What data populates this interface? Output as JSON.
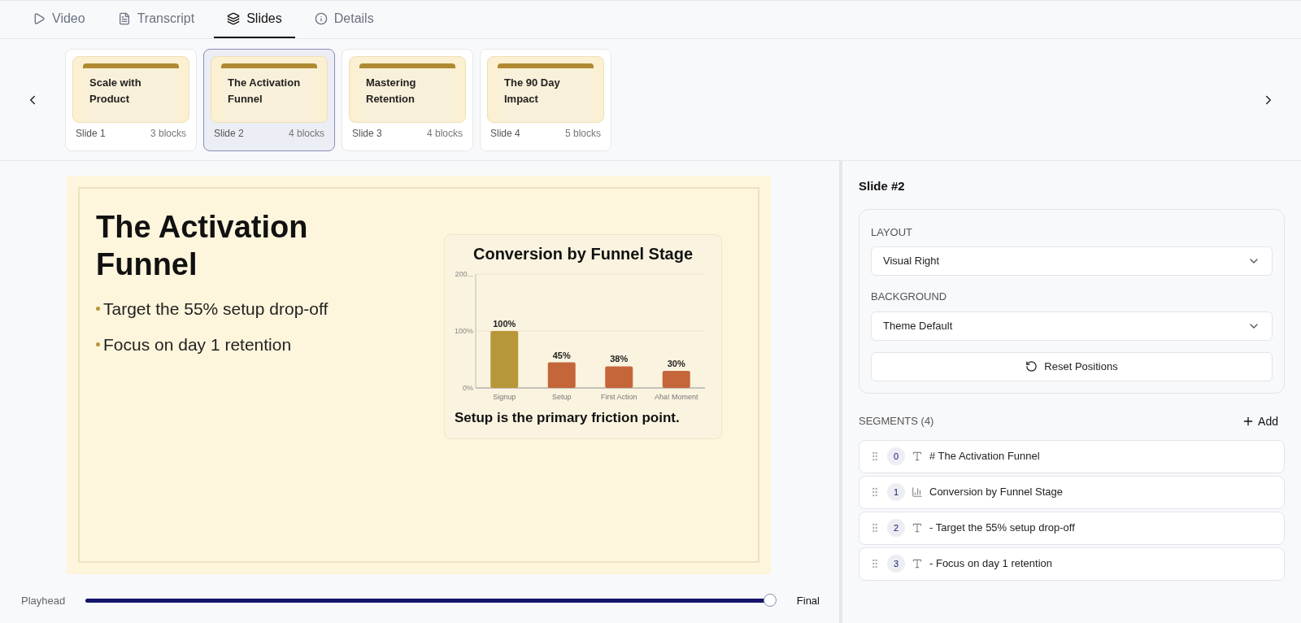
{
  "tabs": [
    {
      "label": "Video",
      "selected": false
    },
    {
      "label": "Transcript",
      "selected": false
    },
    {
      "label": "Slides",
      "selected": true
    },
    {
      "label": "Details",
      "selected": false
    }
  ],
  "slides": [
    {
      "title": "Scale with Product",
      "label": "Slide 1",
      "blocks": "3 blocks",
      "selected": false
    },
    {
      "title": "The Activation Funnel",
      "label": "Slide 2",
      "blocks": "4 blocks",
      "selected": true
    },
    {
      "title": "Mastering Retention",
      "label": "Slide 3",
      "blocks": "4 blocks",
      "selected": false
    },
    {
      "title": "The 90 Day Impact",
      "label": "Slide 4",
      "blocks": "5 blocks",
      "selected": false
    }
  ],
  "preview": {
    "title": "The Activation Funnel",
    "bullets": [
      "Target the 55% setup drop-off",
      "Focus on day 1 retention"
    ],
    "chart": {
      "caption": "Setup is the primary friction point.",
      "chart_data": {
        "type": "bar",
        "title": "Conversion by Funnel Stage",
        "categories": [
          "Signup",
          "Setup",
          "First Action",
          "Aha! Moment"
        ],
        "series": [
          {
            "color": "#b8973a",
            "values": [
              100,
              null,
              null,
              null
            ]
          },
          {
            "color": "#c4663a",
            "values": [
              null,
              45,
              38,
              30
            ]
          }
        ],
        "ylim": [
          0,
          200
        ],
        "yticks": [
          {
            "value": 0,
            "label": "0%"
          },
          {
            "value": 100,
            "label": "100%"
          },
          {
            "value": 200,
            "label": "200..."
          }
        ],
        "value_labels": [
          "100%",
          "45%",
          "38%",
          "30%"
        ]
      }
    }
  },
  "playhead": {
    "label": "Playhead",
    "level": 1,
    "reading": "Final"
  },
  "inspector": {
    "title": "Slide #2",
    "layout_label": "LAYOUT",
    "layout_value": "Visual Right",
    "background_label": "BACKGROUND",
    "background_value": "Theme Default",
    "reset_button": "Reset Positions",
    "segments_label": "SEGMENTS (4)",
    "add_button": "Add",
    "segments": [
      {
        "index": "0",
        "kind": "text",
        "text": "# The Activation Funnel"
      },
      {
        "index": "1",
        "kind": "chart",
        "text": "Conversion by Funnel Stage"
      },
      {
        "index": "2",
        "kind": "text",
        "text": "- Target the 55% setup drop-off"
      },
      {
        "index": "3",
        "kind": "text",
        "text": "- Focus on day 1 retention"
      }
    ]
  }
}
